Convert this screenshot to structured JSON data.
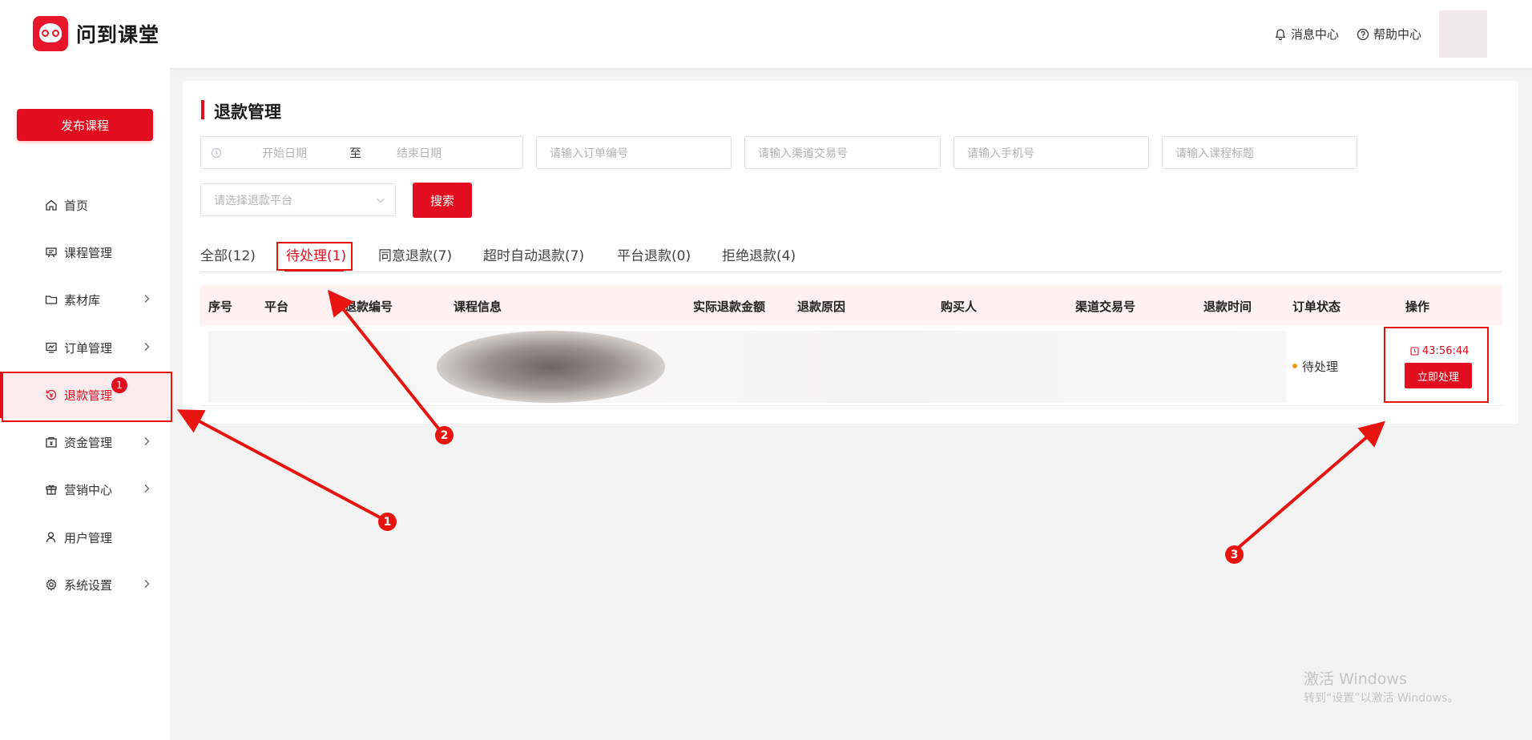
{
  "header": {
    "app_name": "问到课堂",
    "messages_label": "消息中心",
    "help_label": "帮助中心"
  },
  "sidebar": {
    "publish_label": "发布课程",
    "items": [
      {
        "label": "首页",
        "icon": "home-icon"
      },
      {
        "label": "课程管理",
        "icon": "course-icon"
      },
      {
        "label": "素材库",
        "icon": "folder-icon"
      },
      {
        "label": "订单管理",
        "icon": "order-icon"
      },
      {
        "label": "退款管理",
        "icon": "refund-icon",
        "badge": "1",
        "active": true
      },
      {
        "label": "资金管理",
        "icon": "wallet-icon"
      },
      {
        "label": "营销中心",
        "icon": "gift-icon"
      },
      {
        "label": "用户管理",
        "icon": "user-icon"
      },
      {
        "label": "系统设置",
        "icon": "gear-icon"
      }
    ]
  },
  "page": {
    "title": "退款管理",
    "filters": {
      "start_date": "开始日期",
      "date_separator": "至",
      "end_date": "结束日期",
      "order_no": "请输入订单编号",
      "channel_txn": "请输入渠道交易号",
      "phone": "请输入手机号",
      "course_title": "请输入课程标题",
      "platform": "请选择退款平台",
      "search_label": "搜索"
    },
    "tabs": [
      {
        "label": "全部(12)"
      },
      {
        "label": "待处理(1)",
        "active": true
      },
      {
        "label": "同意退款(7)"
      },
      {
        "label": "超时自动退款(7)"
      },
      {
        "label": "平台退款(0)"
      },
      {
        "label": "拒绝退款(4)"
      }
    ],
    "table": {
      "columns": [
        "序号",
        "平台",
        "退款编号",
        "课程信息",
        "实际退款金额",
        "退款原因",
        "购买人",
        "渠道交易号",
        "退款时间",
        "订单状态",
        "操作"
      ],
      "rows": [
        {
          "status": "待处理",
          "countdown": "43:56:44",
          "action": "立即处理"
        }
      ]
    }
  },
  "annotations": [
    "1",
    "2",
    "3"
  ],
  "watermark": {
    "line1": "激活 Windows",
    "line2": "转到“设置”以激活 Windows。"
  },
  "colors": {
    "brand": "#e20d1f",
    "annotation": "#e8140f",
    "pending_dot": "#f39c12"
  }
}
